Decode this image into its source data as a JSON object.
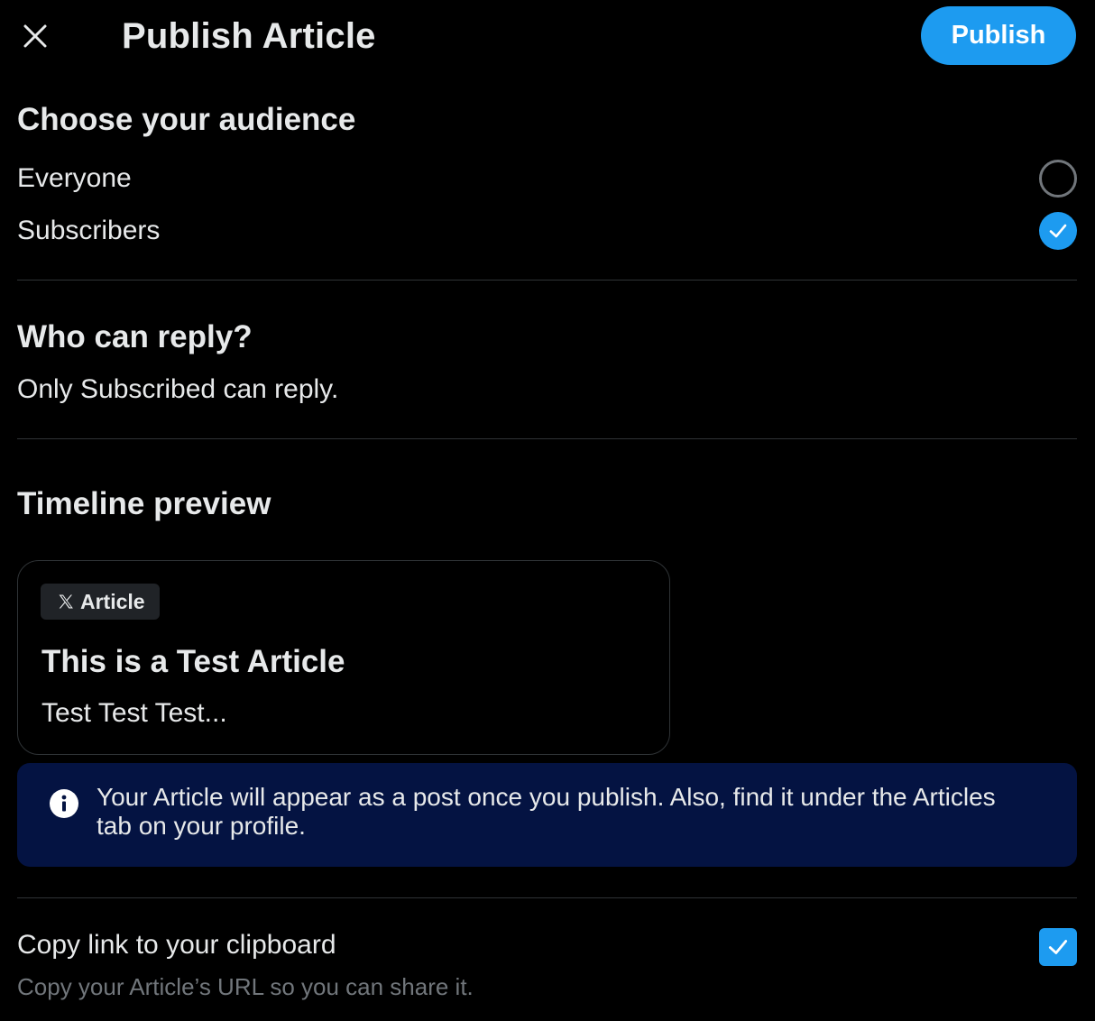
{
  "header": {
    "close_icon": "close-icon",
    "title": "Publish Article",
    "publish_label": "Publish"
  },
  "audience": {
    "heading": "Choose your audience",
    "options": [
      {
        "label": "Everyone",
        "selected": false
      },
      {
        "label": "Subscribers",
        "selected": true
      }
    ]
  },
  "reply": {
    "heading": "Who can reply?",
    "description": "Only Subscribed can reply."
  },
  "timeline_preview": {
    "heading": "Timeline preview",
    "badge_icon": "x-logo-icon",
    "badge_label": "Article",
    "article_title": "This is a Test Article",
    "article_excerpt": "Test Test Test..."
  },
  "info": {
    "icon": "info-icon",
    "text": "Your Article will appear as a post once you publish. Also, find it under the Articles tab on your profile."
  },
  "copy_link": {
    "title": "Copy link to your clipboard",
    "subtitle": "Copy your Article’s URL so you can share it.",
    "checked": true
  },
  "colors": {
    "accent": "#1d9bf0",
    "background": "#000000",
    "info_background": "#041342",
    "divider": "#2f3336",
    "secondary_text": "#71767b"
  }
}
